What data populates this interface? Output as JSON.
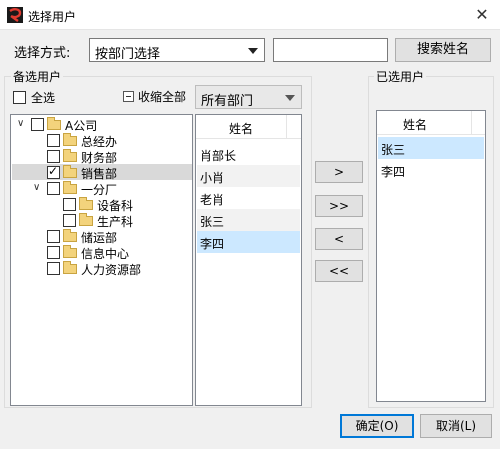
{
  "window": {
    "title": "选择用户",
    "close_glyph": "✕",
    "icon": "app-logo-icon"
  },
  "select_mode": {
    "label": "选择方式:",
    "value": "按部门选择",
    "search_value": "",
    "search_button": "搜索姓名"
  },
  "candidates": {
    "title": "备选用户",
    "select_all_label": "全选",
    "collapse_all_label": "收缩全部",
    "department_filter": "所有部门",
    "tree": [
      {
        "label": "A公司",
        "toggle": "∨",
        "checked": false,
        "selected": false
      },
      {
        "label": "总经办",
        "checked": false,
        "selected": false
      },
      {
        "label": "财务部",
        "checked": false,
        "selected": false
      },
      {
        "label": "销售部",
        "checked": true,
        "selected": true
      },
      {
        "label": "一分厂",
        "toggle": "∨",
        "checked": false,
        "selected": false
      },
      {
        "label": "设备科",
        "checked": false,
        "selected": false
      },
      {
        "label": "生产科",
        "checked": false,
        "selected": false
      },
      {
        "label": "储运部",
        "checked": false,
        "selected": false
      },
      {
        "label": "信息中心",
        "checked": false,
        "selected": false
      },
      {
        "label": "人力资源部",
        "checked": false,
        "selected": false
      }
    ],
    "list_header": "姓名",
    "users": [
      {
        "name": "肖部长",
        "state": "normal"
      },
      {
        "name": "小肖",
        "state": "alt"
      },
      {
        "name": "老肖",
        "state": "normal"
      },
      {
        "name": "张三",
        "state": "alt"
      },
      {
        "name": "李四",
        "state": "selected"
      }
    ]
  },
  "transfer_buttons": {
    "add": ">",
    "add_all": ">>",
    "remove": "<",
    "remove_all": "<<"
  },
  "selected_users": {
    "title": "已选用户",
    "list_header": "姓名",
    "users": [
      {
        "name": "张三",
        "state": "selected"
      },
      {
        "name": "李四",
        "state": "normal"
      }
    ]
  },
  "footer": {
    "ok_label": "确定(O)",
    "cancel_label": "取消(L)"
  },
  "colors": {
    "selection": "#cce8ff",
    "tree_selection": "#d9d9d9",
    "primary_border": "#0078d7",
    "folder": "#f3d37c"
  }
}
